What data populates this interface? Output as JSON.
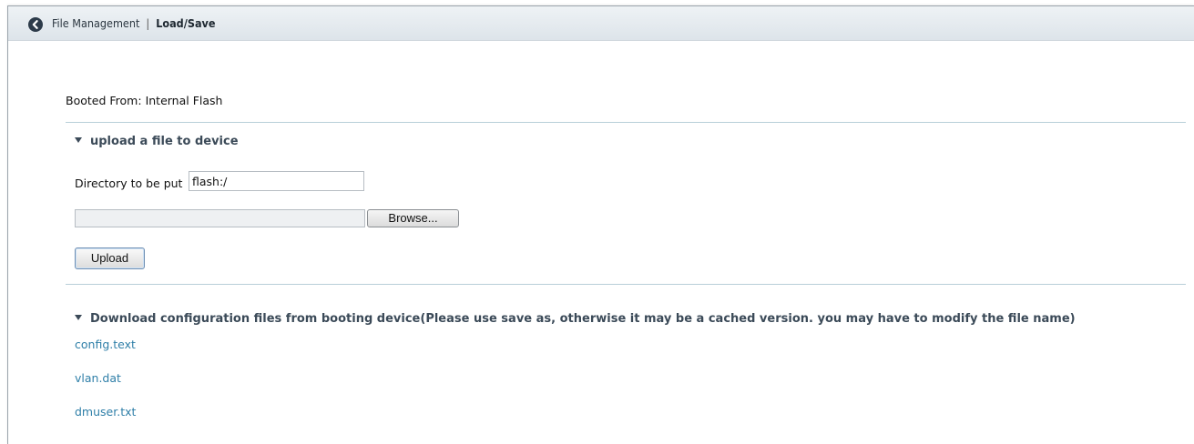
{
  "header": {
    "back_icon": "chevron-left-circle-icon",
    "section": "File Management",
    "separator": "|",
    "current": "Load/Save"
  },
  "boot": {
    "label": "Booted From:",
    "value": "Internal Flash"
  },
  "upload_section": {
    "title": "upload a file to device",
    "dir_label": "Directory to be put",
    "dir_value": "flash:/",
    "browse_label": "Browse...",
    "upload_label": "Upload"
  },
  "download_section": {
    "title": "Download configuration files from booting device(Please use save as, otherwise it may be a cached version. you may have to modify the file name)",
    "files": [
      "config.text",
      "vlan.dat",
      "dmuser.txt"
    ]
  },
  "colors": {
    "link": "#2f7fa8",
    "header_bg": "#dde4ea",
    "divider": "#b8cfd9"
  }
}
